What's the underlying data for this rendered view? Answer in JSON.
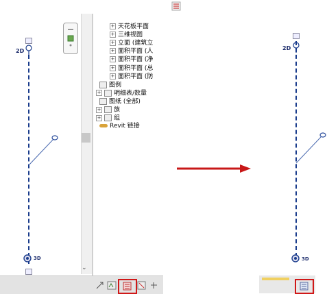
{
  "tree": {
    "items": [
      {
        "label": "天花板平面",
        "expander": "+",
        "indent": 20
      },
      {
        "label": "三维视图",
        "expander": "+",
        "indent": 20
      },
      {
        "label": "立面 (建筑立",
        "expander": "+",
        "indent": 20
      },
      {
        "label": "面积平面 (人",
        "expander": "+",
        "indent": 20
      },
      {
        "label": "面积平面 (净",
        "expander": "+",
        "indent": 20
      },
      {
        "label": "面积平面 (总",
        "expander": "+",
        "indent": 20
      },
      {
        "label": "面积平面 (防",
        "expander": "+",
        "indent": 20
      },
      {
        "label": "图例",
        "expander": "",
        "indent": 5
      },
      {
        "label": "明细表/数量",
        "expander": "+",
        "indent": 0
      },
      {
        "label": "图纸 (全部)",
        "expander": "",
        "indent": 5
      },
      {
        "label": "族",
        "expander": "+",
        "indent": 0
      },
      {
        "label": "组",
        "expander": "+",
        "indent": 0
      },
      {
        "label": "Revit 链接",
        "expander": "",
        "indent": 5
      }
    ]
  },
  "left_view": {
    "label_2d": "2D",
    "label_3d": "3D"
  },
  "right_view": {
    "label_2d": "2D",
    "label_3d": "3D"
  },
  "scroll": {
    "right_arrow": ">",
    "down_arrow": "⌄"
  },
  "colors": {
    "arrow": "#d01818",
    "highlight": "#d01818",
    "axis": "#1a3c8c"
  }
}
